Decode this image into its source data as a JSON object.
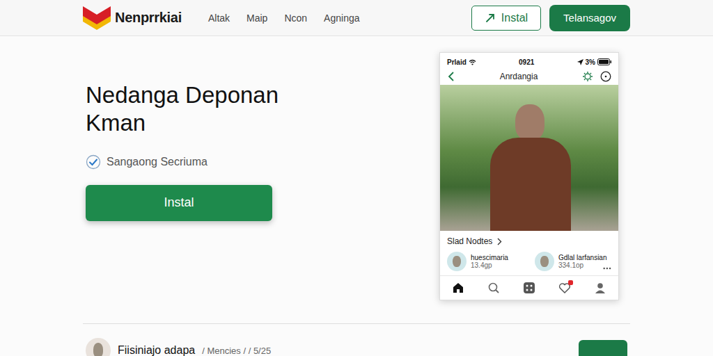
{
  "brand": {
    "name": "Nenprrkiai"
  },
  "nav": {
    "links": [
      "Altak",
      "Maip",
      "Ncon",
      "Agninga"
    ],
    "outline_button": "Instal",
    "primary_button": "Telansagov"
  },
  "hero": {
    "title": "Nedanga Deponan Kman",
    "feature": "Sangaong Secriuma",
    "feature_checked": true,
    "cta": "Instal"
  },
  "phone": {
    "status": {
      "carrier": "Prlaid",
      "time": "0921",
      "battery": "3%"
    },
    "title": "Anrdangia",
    "section": "Slad Nodtes",
    "users": [
      {
        "name": "huescimaria",
        "meta": "13.4gp"
      },
      {
        "name": "Gdlal larfansian",
        "meta": "334.1op"
      }
    ],
    "tabs": [
      {
        "kind": "home",
        "selected": true,
        "badge": false
      },
      {
        "kind": "search",
        "selected": false,
        "badge": false
      },
      {
        "kind": "grid",
        "selected": false,
        "badge": false
      },
      {
        "kind": "heart",
        "selected": false,
        "badge": true
      },
      {
        "kind": "person",
        "selected": false,
        "badge": false
      }
    ]
  },
  "footer_row": {
    "title": "Fiisiniajo adapa",
    "meta": "/ Mencies / / 5/25"
  }
}
